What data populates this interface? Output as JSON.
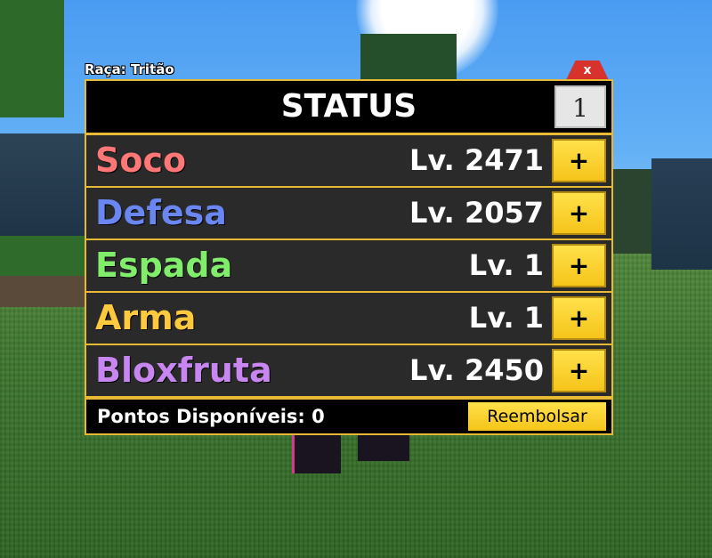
{
  "player": {
    "race_label": "Raça: Tritão"
  },
  "status_window": {
    "title": "STATUS",
    "page": "1",
    "close_label": "x"
  },
  "stats": [
    {
      "name": "Soco",
      "level": "Lv. 2471",
      "color": "#ff7777",
      "button": "+"
    },
    {
      "name": "Defesa",
      "level": "Lv. 2057",
      "color": "#6a86f0",
      "button": "+"
    },
    {
      "name": "Espada",
      "level": "Lv. 1",
      "color": "#80ee6a",
      "button": "+"
    },
    {
      "name": "Arma",
      "level": "Lv. 1",
      "color": "#ffc93d",
      "button": "+"
    },
    {
      "name": "Bloxfruta",
      "level": "Lv. 2450",
      "color": "#c786f0",
      "button": "+"
    }
  ],
  "footer": {
    "points_label": "Pontos Disponíveis: 0",
    "refund_button": "Reembolsar"
  },
  "colors": {
    "panel_border": "#e8b935",
    "button_yellow": "#f5c41a",
    "close_red": "#d8322c"
  }
}
